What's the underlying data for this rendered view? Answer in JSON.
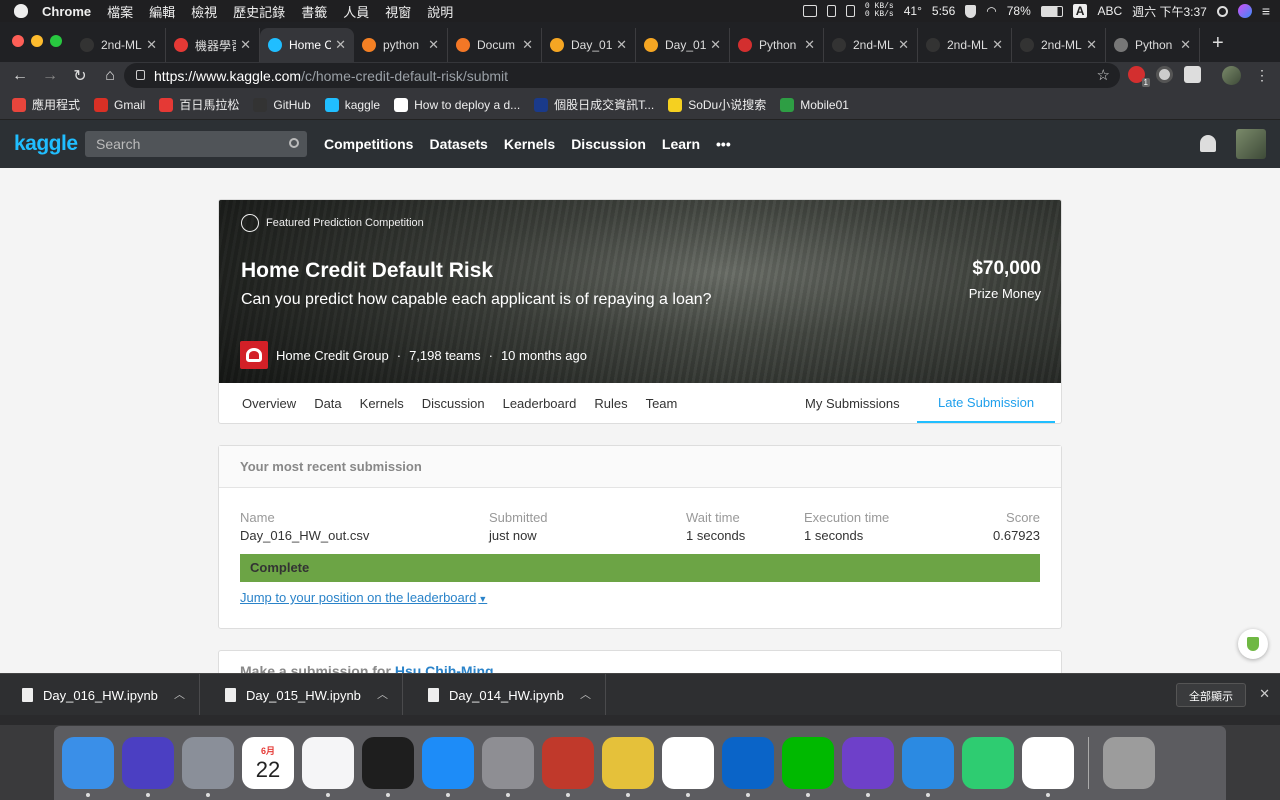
{
  "menubar": {
    "app_name": "Chrome",
    "menus": [
      "檔案",
      "編輯",
      "檢視",
      "歷史記錄",
      "書籤",
      "人員",
      "視窗",
      "說明"
    ],
    "net_up": "0 KB/s",
    "net_down": "0 KB/s",
    "temperature": "41°",
    "timer": "5:56",
    "battery": "78%",
    "input_method": "ABC",
    "datetime": "週六 下午3:37"
  },
  "tabs": [
    {
      "label": "2nd-ML",
      "icon": "github-icon",
      "color": "#333333"
    },
    {
      "label": "機器學習",
      "icon": "record-icon",
      "color": "#e53935"
    },
    {
      "label": "Home C",
      "icon": "kaggle-icon",
      "color": "#20beff",
      "active": true
    },
    {
      "label": "python",
      "icon": "stackoverflow-icon",
      "color": "#f48024"
    },
    {
      "label": "Docum",
      "icon": "jupyter-icon",
      "color": "#f37726"
    },
    {
      "label": "Day_01",
      "icon": "notebook-icon",
      "color": "#f5a623"
    },
    {
      "label": "Day_01",
      "icon": "notebook-icon",
      "color": "#f5a623"
    },
    {
      "label": "Python",
      "icon": "c-icon",
      "color": "#d32f2f"
    },
    {
      "label": "2nd-ML",
      "icon": "github-icon",
      "color": "#333333"
    },
    {
      "label": "2nd-ML",
      "icon": "github-icon",
      "color": "#333333"
    },
    {
      "label": "2nd-ML",
      "icon": "github-icon",
      "color": "#333333"
    },
    {
      "label": "Python",
      "icon": "globe-icon",
      "color": "#777777"
    }
  ],
  "toolbar": {
    "url_host": "https://www.kaggle.com",
    "url_path": "/c/home-credit-default-risk/submit",
    "ext_badge": "1"
  },
  "bookmarks": [
    {
      "label": "應用程式",
      "color": "#e8453c"
    },
    {
      "label": "Gmail",
      "color": "#d93025"
    },
    {
      "label": "百日馬拉松",
      "color": "#e53935"
    },
    {
      "label": "GitHub",
      "color": "#333333"
    },
    {
      "label": "kaggle",
      "color": "#20beff"
    },
    {
      "label": "How to deploy a d...",
      "color": "#ffffff"
    },
    {
      "label": "個股日成交資訊T...",
      "color": "#1a3a8a"
    },
    {
      "label": "SoDu小说搜索",
      "color": "#f5d020"
    },
    {
      "label": "Mobile01",
      "color": "#2e9e44"
    }
  ],
  "kaggle": {
    "logo": "kaggle",
    "search_placeholder": "Search",
    "nav": [
      "Competitions",
      "Datasets",
      "Kernels",
      "Discussion",
      "Learn",
      "•••"
    ]
  },
  "competition": {
    "badge": "Featured Prediction Competition",
    "title": "Home Credit Default Risk",
    "subtitle": "Can you predict how capable each applicant is of repaying a loan?",
    "prize": "$70,000",
    "prize_label": "Prize Money",
    "host": "Home Credit Group",
    "teams": "7,198 teams",
    "age": "10 months ago",
    "tabs": [
      "Overview",
      "Data",
      "Kernels",
      "Discussion",
      "Leaderboard",
      "Rules",
      "Team"
    ],
    "my_submissions": "My Submissions",
    "late_submission": "Late Submission"
  },
  "submission": {
    "heading": "Your most recent submission",
    "columns": {
      "name": "Name",
      "submitted": "Submitted",
      "wait": "Wait time",
      "exec": "Execution time",
      "score": "Score"
    },
    "values": {
      "name": "Day_016_HW_out.csv",
      "submitted": "just now",
      "wait": "1 seconds",
      "exec": "1 seconds",
      "score": "0.67923"
    },
    "status": "Complete",
    "jump_link": "Jump to your position on the leaderboard"
  },
  "make_submission": {
    "prefix": "Make a submission for",
    "user": "Hsu Chih-Ming"
  },
  "downloads": {
    "files": [
      "Day_016_HW.ipynb",
      "Day_015_HW.ipynb",
      "Day_014_HW.ipynb"
    ],
    "show_all": "全部顯示"
  },
  "dock": [
    {
      "name": "finder",
      "color": "#3a8fe8"
    },
    {
      "name": "siri",
      "color": "#4b3fc2"
    },
    {
      "name": "launchpad",
      "color": "#8a8f99"
    },
    {
      "name": "calendar",
      "color": "#ffffff",
      "month": "6月",
      "day": "22"
    },
    {
      "name": "music",
      "color": "#f5f5f7"
    },
    {
      "name": "terminal",
      "color": "#1e1e1e"
    },
    {
      "name": "app-store",
      "color": "#1d8cf8"
    },
    {
      "name": "system-preferences",
      "color": "#8e8e93"
    },
    {
      "name": "sync-app",
      "color": "#c0392b"
    },
    {
      "name": "ultraedit",
      "color": "#e5c13a"
    },
    {
      "name": "chrome",
      "color": "#ffffff"
    },
    {
      "name": "outlook",
      "color": "#0a64c8"
    },
    {
      "name": "line",
      "color": "#00b900"
    },
    {
      "name": "github-desktop",
      "color": "#6e40c9"
    },
    {
      "name": "vscode",
      "color": "#2b8ae2"
    },
    {
      "name": "circle-app",
      "color": "#2ecc71"
    },
    {
      "name": "numbers",
      "color": "#ffffff"
    },
    {
      "name": "trash",
      "color": "#9c9c9c"
    }
  ]
}
